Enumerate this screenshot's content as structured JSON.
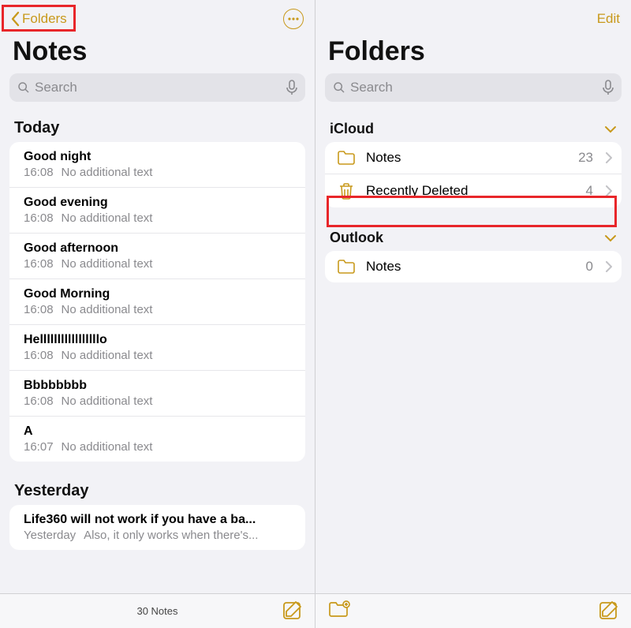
{
  "left": {
    "back_label": "Folders",
    "title": "Notes",
    "search_placeholder": "Search",
    "sections": {
      "today": {
        "header": "Today",
        "notes": [
          {
            "title": "Good night",
            "time": "16:08",
            "snippet": "No additional text"
          },
          {
            "title": "Good evening",
            "time": "16:08",
            "snippet": "No additional text"
          },
          {
            "title": "Good afternoon",
            "time": "16:08",
            "snippet": "No additional text"
          },
          {
            "title": "Good Morning",
            "time": "16:08",
            "snippet": "No additional text"
          },
          {
            "title": "Helllllllllllllllllo",
            "time": "16:08",
            "snippet": "No additional text"
          },
          {
            "title": "Bbbbbbbb",
            "time": "16:08",
            "snippet": "No additional text"
          },
          {
            "title": "A",
            "time": "16:07",
            "snippet": "No additional text"
          }
        ]
      },
      "yesterday": {
        "header": "Yesterday",
        "notes": [
          {
            "title": "Life360 will not work if you have a ba...",
            "time": "Yesterday",
            "snippet": "Also, it only works when there's..."
          }
        ]
      }
    },
    "footer": {
      "count_label": "30 Notes"
    }
  },
  "right": {
    "edit_label": "Edit",
    "title": "Folders",
    "search_placeholder": "Search",
    "accounts": [
      {
        "name": "iCloud",
        "folders": [
          {
            "icon": "folder",
            "name": "Notes",
            "count": "23"
          },
          {
            "icon": "trash",
            "name": "Recently Deleted",
            "count": "4"
          }
        ]
      },
      {
        "name": "Outlook",
        "folders": [
          {
            "icon": "folder",
            "name": "Notes",
            "count": "0"
          }
        ]
      }
    ]
  }
}
